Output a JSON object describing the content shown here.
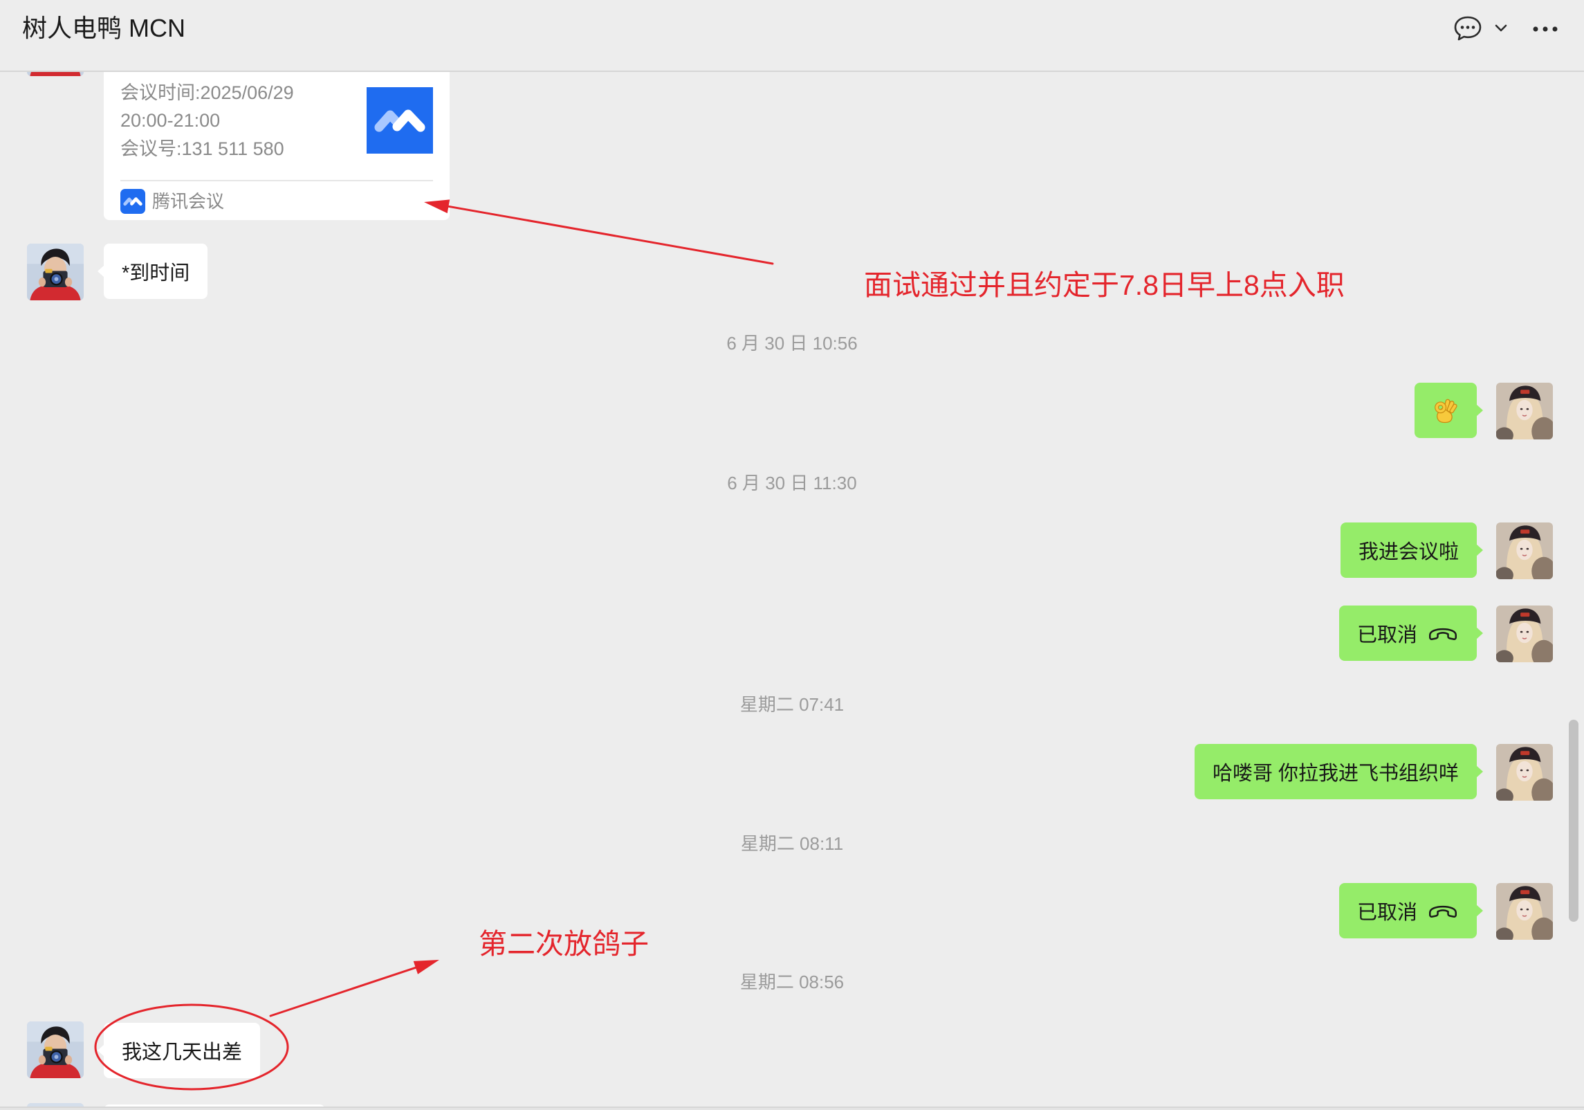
{
  "window": {
    "title": "树人电鸭 MCN"
  },
  "header": {
    "icons": [
      "chat-bubble-icon",
      "chevron-down-icon",
      "more-icon"
    ]
  },
  "meeting_card": {
    "time_label": "会议时间:2025/06/29",
    "time_range": "20:00-21:00",
    "meeting_id": "会议号:131 511 580",
    "app_name": "腾讯会议",
    "logo_icon": "tencent-meeting-logo-icon"
  },
  "timestamps": [
    "6 月 30 日 10:56",
    "6 月 30 日 11:30",
    "星期二 07:41",
    "星期二 08:11",
    "星期二 08:56"
  ],
  "messages": [
    {
      "text": "*到时间"
    },
    {
      "icon": "ok-hand-emoji"
    },
    {
      "text": "我进会议啦"
    },
    {
      "text": "已取消",
      "icon": "phone-hangup-icon"
    },
    {
      "text": "哈喽哥 你拉我进飞书组织咩"
    },
    {
      "text": "已取消",
      "icon": "phone-hangup-icon"
    },
    {
      "text": "我这几天出差"
    }
  ],
  "annotations": {
    "note_interview": "面试通过并且约定于7.8日早上8点入职",
    "note_second": "第二次放鸽子",
    "color": "#e4252c"
  },
  "colors": {
    "background": "#ededed",
    "bubble_sent": "#95ec69",
    "bubble_received": "#ffffff",
    "timestamp": "#9b9b9b",
    "brand_meeting": "#1f6cf0"
  }
}
